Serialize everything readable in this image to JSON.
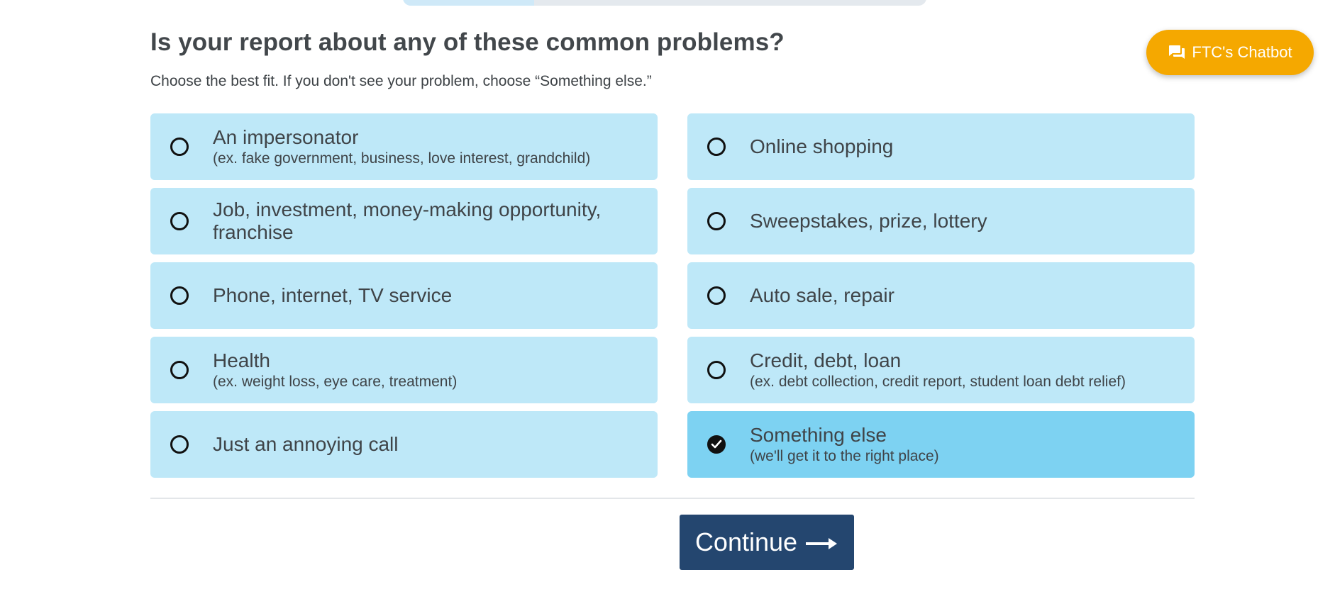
{
  "header": {
    "title": "Is your report about any of these common problems?",
    "subtitle": "Choose the best fit. If you don't see your problem, choose “Something else.”"
  },
  "progress": {
    "percent": 25
  },
  "chatbot": {
    "label": "FTC's Chatbot",
    "color": "#f5a800",
    "icon": "chat-bubbles-icon"
  },
  "options": [
    {
      "label": "An impersonator",
      "sub": "(ex. fake government, business, love interest, grandchild)",
      "selected": false
    },
    {
      "label": "Online shopping",
      "sub": "",
      "selected": false
    },
    {
      "label": "Job, investment, money-making opportunity, franchise",
      "sub": "",
      "selected": false
    },
    {
      "label": "Sweepstakes, prize, lottery",
      "sub": "",
      "selected": false
    },
    {
      "label": "Phone, internet, TV service",
      "sub": "",
      "selected": false
    },
    {
      "label": "Auto sale, repair",
      "sub": "",
      "selected": false
    },
    {
      "label": "Health",
      "sub": "(ex. weight loss, eye care, treatment)",
      "selected": false
    },
    {
      "label": "Credit, debt, loan",
      "sub": "(ex. debt collection, credit report, student loan debt relief)",
      "selected": false
    },
    {
      "label": "Just an annoying call",
      "sub": "",
      "selected": false
    },
    {
      "label": "Something else",
      "sub": "(we'll get it to the right place)",
      "selected": true
    }
  ],
  "colors": {
    "option_bg": "#bee8f8",
    "option_selected_bg": "#7dd2f2",
    "continue_bg": "#24466f"
  },
  "footer": {
    "continue_label": "Continue",
    "continue_icon": "arrow-right-icon"
  }
}
